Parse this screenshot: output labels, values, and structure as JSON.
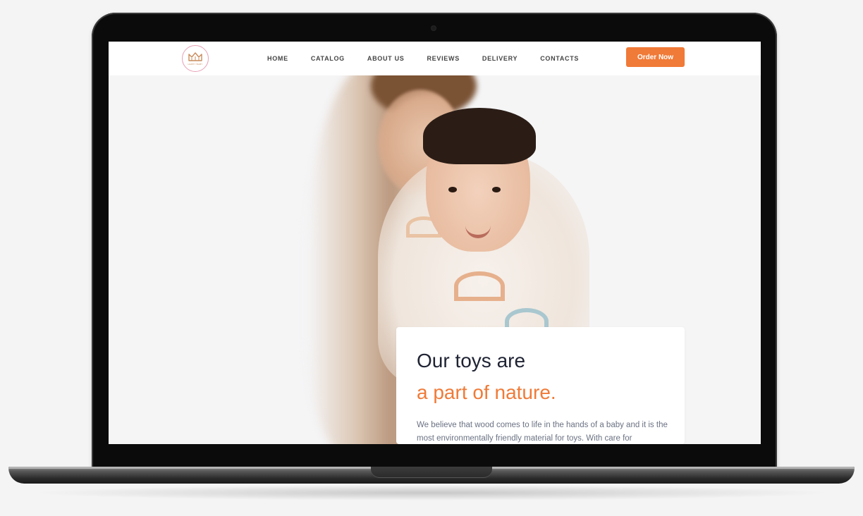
{
  "navbar": {
    "logo_text": "HAPPY BABY",
    "items": [
      {
        "label": "HOME"
      },
      {
        "label": "CATALOG"
      },
      {
        "label": "ABOUT US"
      },
      {
        "label": "REVIEWS"
      },
      {
        "label": "DELIVERY"
      },
      {
        "label": "CONTACTS"
      }
    ],
    "cta_label": "Order Now"
  },
  "hero": {
    "heading_line1": "Our toys are",
    "heading_line2": "a part of nature.",
    "paragraph": "We believe that wood comes to life in the hands of a baby and it is the most environmentally friendly material for toys. With care for"
  },
  "colors": {
    "accent": "#f07a37",
    "heading": "#1f2333",
    "body_text": "#6b7283",
    "page_bg": "#f5f5f6"
  },
  "icons": {
    "logo": "crown-icon"
  }
}
